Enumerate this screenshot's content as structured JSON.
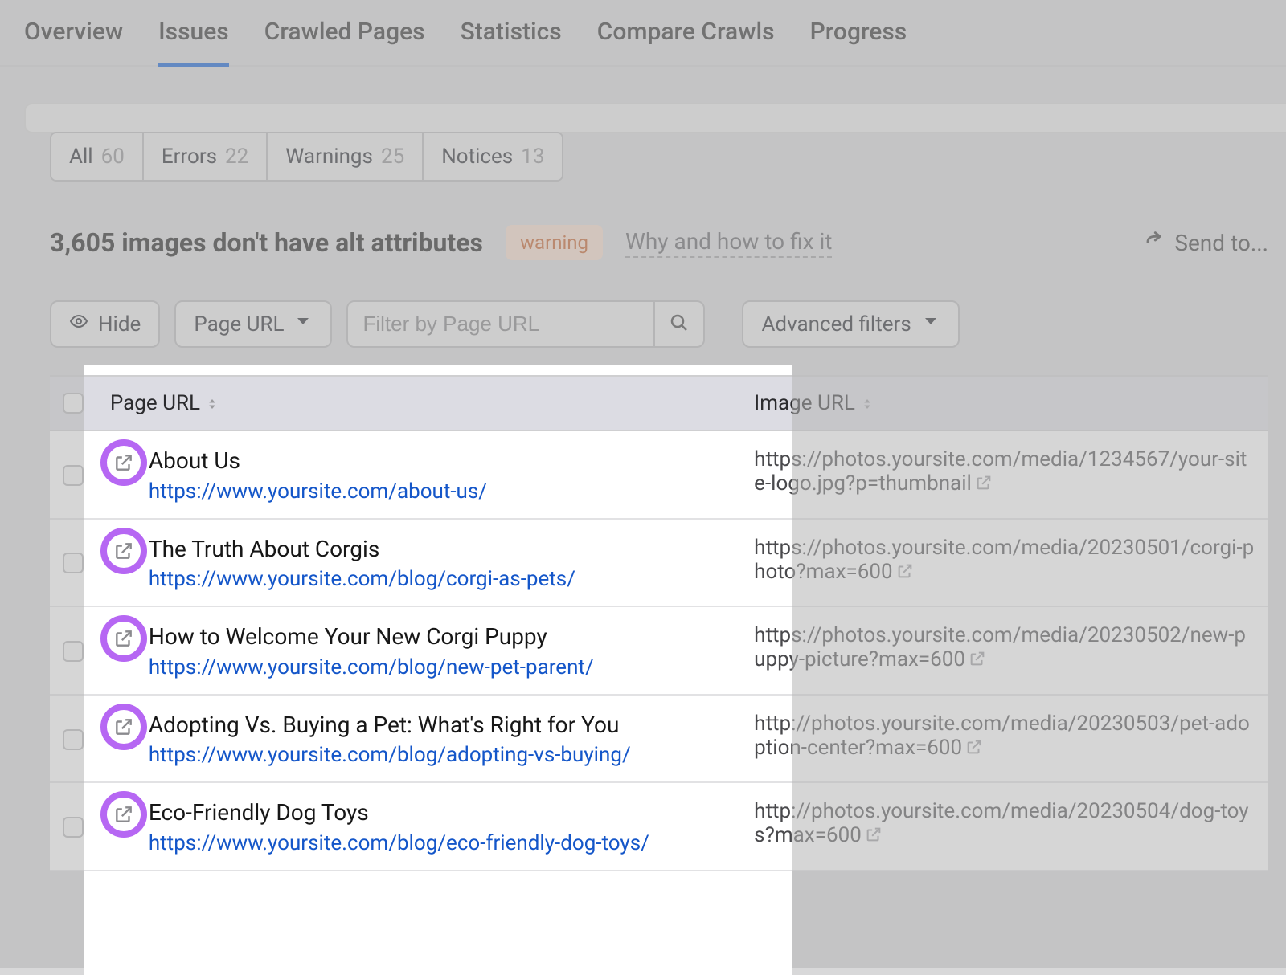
{
  "tabs": [
    "Overview",
    "Issues",
    "Crawled Pages",
    "Statistics",
    "Compare Crawls",
    "Progress"
  ],
  "activeTabIndex": 1,
  "pills": [
    {
      "label": "All",
      "count": "60"
    },
    {
      "label": "Errors",
      "count": "22"
    },
    {
      "label": "Warnings",
      "count": "25"
    },
    {
      "label": "Notices",
      "count": "13"
    }
  ],
  "headline": "3,605 images don't have alt attributes",
  "warningBadge": "warning",
  "howToFix": "Why and how to fix it",
  "sendTo": "Send to...",
  "hideBtn": "Hide",
  "filterTypeBtn": "Page URL",
  "filterPlaceholder": "Filter by Page URL",
  "advancedFilters": "Advanced filters",
  "columns": {
    "pageUrl": "Page URL",
    "imageUrl": "Image URL"
  },
  "rows": [
    {
      "title": "About Us",
      "url": "https://www.yoursite.com/about-us/",
      "imageUrl": "https://photos.yoursite.com/media/1234567/your-site-logo.jpg?p=thumbnail"
    },
    {
      "title": "The Truth About Corgis",
      "url": "https://www.yoursite.com/blog/corgi-as-pets/",
      "imageUrl": "https://photos.yoursite.com/media/20230501/corgi-photo?max=600"
    },
    {
      "title": "How to Welcome Your New Corgi Puppy",
      "url": "https://www.yoursite.com/blog/new-pet-parent/",
      "imageUrl": "https://photos.yoursite.com/media/20230502/new-puppy-picture?max=600"
    },
    {
      "title": "Adopting Vs. Buying a Pet: What's Right for You",
      "url": "https://www.yoursite.com/blog/adopting-vs-buying/",
      "imageUrl": "http://photos.yoursite.com/media/20230503/pet-adoption-center?max=600"
    },
    {
      "title": "Eco-Friendly Dog Toys",
      "url": "https://www.yoursite.com/blog/eco-friendly-dog-toys/",
      "imageUrl": "http://photos.yoursite.com/media/20230504/dog-toys?max=600"
    }
  ]
}
